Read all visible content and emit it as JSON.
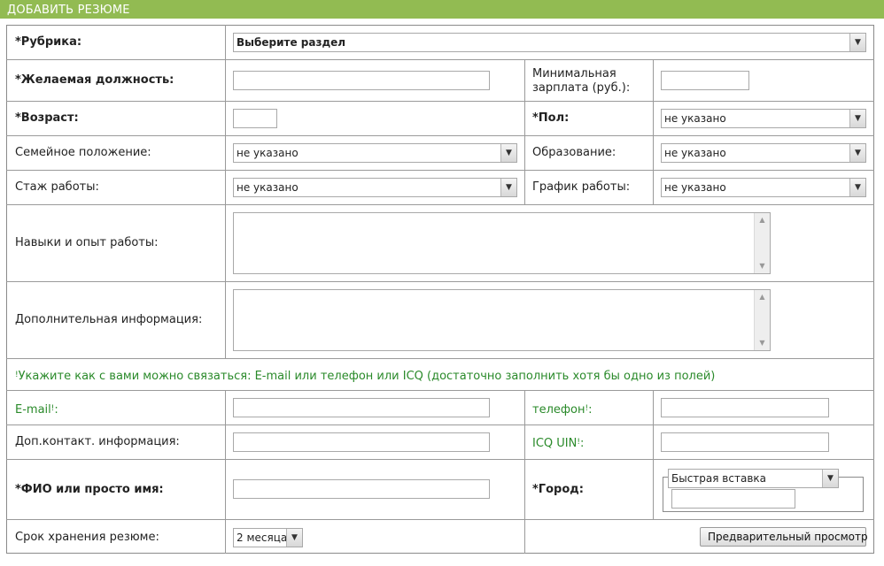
{
  "header": {
    "title": "ДОБАВИТЬ РЕЗЮМЕ"
  },
  "rubric": {
    "label": "*Рубрика:",
    "value": "Выберите раздел"
  },
  "position": {
    "label": "*Желаемая должность:",
    "value": ""
  },
  "salary": {
    "label_line1": "Минимальная",
    "label_line2": "зарплата (руб.):",
    "value": ""
  },
  "age": {
    "label": "*Возраст:",
    "value": ""
  },
  "gender": {
    "label": "*Пол:",
    "value": "не указано"
  },
  "marital": {
    "label": "Семейное положение:",
    "value": "не указано"
  },
  "education": {
    "label": "Образование:",
    "value": "не указано"
  },
  "experience": {
    "label": "Стаж работы:",
    "value": "не указано"
  },
  "schedule": {
    "label": "График работы:",
    "value": "не указано"
  },
  "skills": {
    "label": "Навыки и опыт работы:",
    "value": ""
  },
  "extra": {
    "label": "Дополнительная информация:",
    "value": ""
  },
  "contact_note": {
    "mark": "!",
    "text": "Укажите как с вами можно связаться: E-mail или телефон или ICQ (достаточно заполнить хотя бы одно из полей)"
  },
  "email": {
    "label": "E-mail",
    "mark": "!",
    "suffix": ":",
    "value": ""
  },
  "phone": {
    "label": "телефон",
    "mark": "!",
    "suffix": ":",
    "value": ""
  },
  "extra_contact": {
    "label": "Доп.контакт. информация:",
    "value": ""
  },
  "icq": {
    "label": "ICQ UIN",
    "mark": "!",
    "suffix": ":",
    "value": ""
  },
  "name": {
    "label": "*ФИО или просто имя:",
    "value": ""
  },
  "city": {
    "label": "*Город:",
    "quick_insert": "Быстрая вставка",
    "value": ""
  },
  "storage": {
    "label": "Срок хранения резюме:",
    "value": "2 месяца"
  },
  "preview_button": {
    "label": "Предварительный просмотр"
  },
  "icons": {
    "select_arrow": "triangle-down",
    "scroll_up": "triangle-up",
    "scroll_down": "triangle-down"
  },
  "colors": {
    "header_bg": "#92bb52",
    "note_green": "#2a8a2a"
  }
}
